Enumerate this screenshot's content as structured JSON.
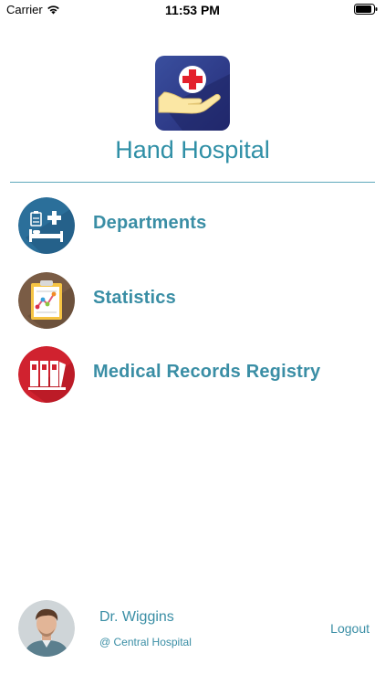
{
  "status_bar": {
    "carrier": "Carrier",
    "time": "11:53 PM",
    "wifi_icon": "wifi-icon",
    "battery_icon": "battery-icon"
  },
  "app": {
    "title": "Hand Hospital",
    "logo_icon": "hand-hospital-logo-icon",
    "title_color": "#2f8fa6"
  },
  "menu": {
    "items": [
      {
        "label": "Departments",
        "icon": "hospital-bed-icon",
        "color": "#2b6f9a"
      },
      {
        "label": "Statistics",
        "icon": "clipboard-chart-icon",
        "color": "#7a5c45"
      },
      {
        "label": "Medical Records Registry",
        "icon": "binders-icon",
        "color": "#d0222f"
      }
    ]
  },
  "profile": {
    "name": "Dr. Wiggins",
    "hospital": "@ Central Hospital",
    "avatar_icon": "doctor-avatar",
    "logout_label": "Logout"
  }
}
